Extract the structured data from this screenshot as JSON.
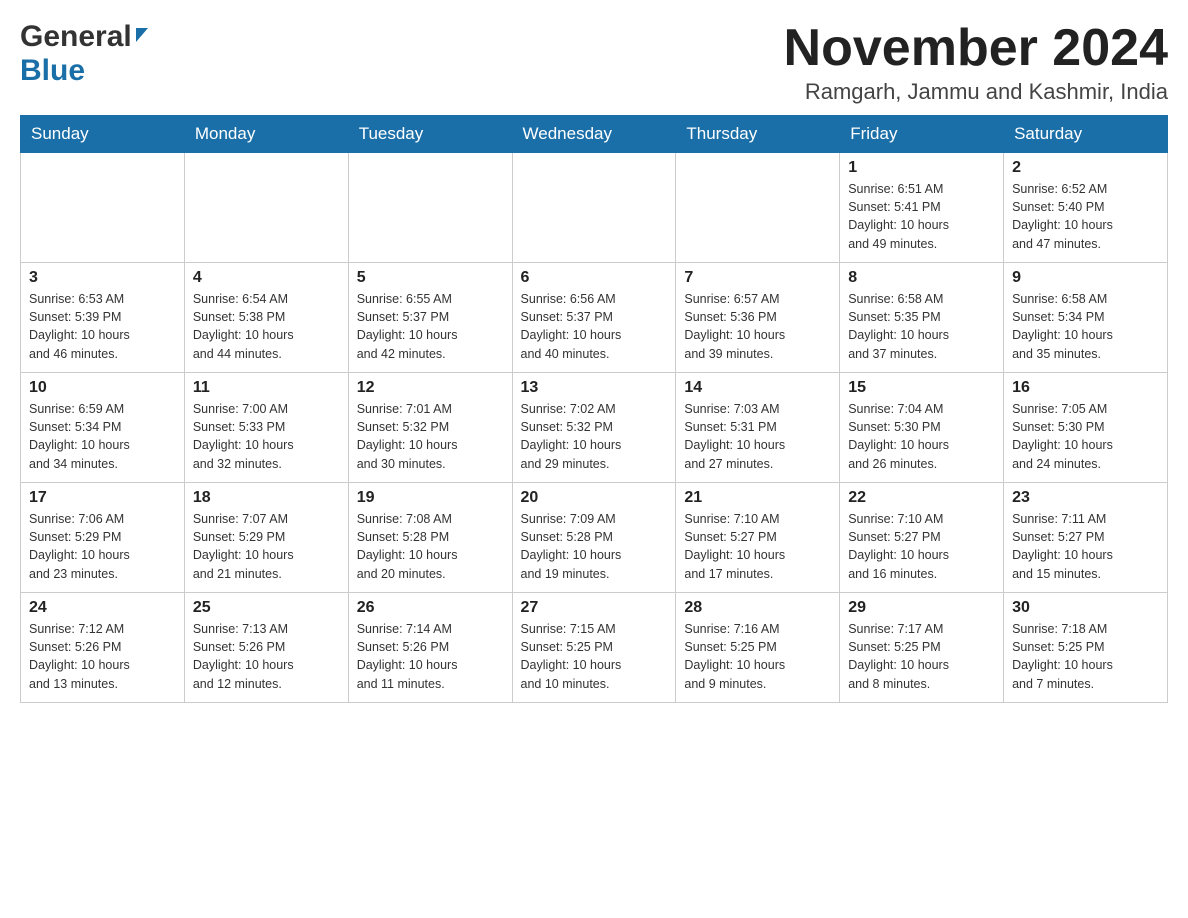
{
  "header": {
    "logo_general": "General",
    "logo_blue": "Blue",
    "month_title": "November 2024",
    "location": "Ramgarh, Jammu and Kashmir, India"
  },
  "weekdays": [
    "Sunday",
    "Monday",
    "Tuesday",
    "Wednesday",
    "Thursday",
    "Friday",
    "Saturday"
  ],
  "weeks": [
    [
      {
        "day": "",
        "info": ""
      },
      {
        "day": "",
        "info": ""
      },
      {
        "day": "",
        "info": ""
      },
      {
        "day": "",
        "info": ""
      },
      {
        "day": "",
        "info": ""
      },
      {
        "day": "1",
        "info": "Sunrise: 6:51 AM\nSunset: 5:41 PM\nDaylight: 10 hours\nand 49 minutes."
      },
      {
        "day": "2",
        "info": "Sunrise: 6:52 AM\nSunset: 5:40 PM\nDaylight: 10 hours\nand 47 minutes."
      }
    ],
    [
      {
        "day": "3",
        "info": "Sunrise: 6:53 AM\nSunset: 5:39 PM\nDaylight: 10 hours\nand 46 minutes."
      },
      {
        "day": "4",
        "info": "Sunrise: 6:54 AM\nSunset: 5:38 PM\nDaylight: 10 hours\nand 44 minutes."
      },
      {
        "day": "5",
        "info": "Sunrise: 6:55 AM\nSunset: 5:37 PM\nDaylight: 10 hours\nand 42 minutes."
      },
      {
        "day": "6",
        "info": "Sunrise: 6:56 AM\nSunset: 5:37 PM\nDaylight: 10 hours\nand 40 minutes."
      },
      {
        "day": "7",
        "info": "Sunrise: 6:57 AM\nSunset: 5:36 PM\nDaylight: 10 hours\nand 39 minutes."
      },
      {
        "day": "8",
        "info": "Sunrise: 6:58 AM\nSunset: 5:35 PM\nDaylight: 10 hours\nand 37 minutes."
      },
      {
        "day": "9",
        "info": "Sunrise: 6:58 AM\nSunset: 5:34 PM\nDaylight: 10 hours\nand 35 minutes."
      }
    ],
    [
      {
        "day": "10",
        "info": "Sunrise: 6:59 AM\nSunset: 5:34 PM\nDaylight: 10 hours\nand 34 minutes."
      },
      {
        "day": "11",
        "info": "Sunrise: 7:00 AM\nSunset: 5:33 PM\nDaylight: 10 hours\nand 32 minutes."
      },
      {
        "day": "12",
        "info": "Sunrise: 7:01 AM\nSunset: 5:32 PM\nDaylight: 10 hours\nand 30 minutes."
      },
      {
        "day": "13",
        "info": "Sunrise: 7:02 AM\nSunset: 5:32 PM\nDaylight: 10 hours\nand 29 minutes."
      },
      {
        "day": "14",
        "info": "Sunrise: 7:03 AM\nSunset: 5:31 PM\nDaylight: 10 hours\nand 27 minutes."
      },
      {
        "day": "15",
        "info": "Sunrise: 7:04 AM\nSunset: 5:30 PM\nDaylight: 10 hours\nand 26 minutes."
      },
      {
        "day": "16",
        "info": "Sunrise: 7:05 AM\nSunset: 5:30 PM\nDaylight: 10 hours\nand 24 minutes."
      }
    ],
    [
      {
        "day": "17",
        "info": "Sunrise: 7:06 AM\nSunset: 5:29 PM\nDaylight: 10 hours\nand 23 minutes."
      },
      {
        "day": "18",
        "info": "Sunrise: 7:07 AM\nSunset: 5:29 PM\nDaylight: 10 hours\nand 21 minutes."
      },
      {
        "day": "19",
        "info": "Sunrise: 7:08 AM\nSunset: 5:28 PM\nDaylight: 10 hours\nand 20 minutes."
      },
      {
        "day": "20",
        "info": "Sunrise: 7:09 AM\nSunset: 5:28 PM\nDaylight: 10 hours\nand 19 minutes."
      },
      {
        "day": "21",
        "info": "Sunrise: 7:10 AM\nSunset: 5:27 PM\nDaylight: 10 hours\nand 17 minutes."
      },
      {
        "day": "22",
        "info": "Sunrise: 7:10 AM\nSunset: 5:27 PM\nDaylight: 10 hours\nand 16 minutes."
      },
      {
        "day": "23",
        "info": "Sunrise: 7:11 AM\nSunset: 5:27 PM\nDaylight: 10 hours\nand 15 minutes."
      }
    ],
    [
      {
        "day": "24",
        "info": "Sunrise: 7:12 AM\nSunset: 5:26 PM\nDaylight: 10 hours\nand 13 minutes."
      },
      {
        "day": "25",
        "info": "Sunrise: 7:13 AM\nSunset: 5:26 PM\nDaylight: 10 hours\nand 12 minutes."
      },
      {
        "day": "26",
        "info": "Sunrise: 7:14 AM\nSunset: 5:26 PM\nDaylight: 10 hours\nand 11 minutes."
      },
      {
        "day": "27",
        "info": "Sunrise: 7:15 AM\nSunset: 5:25 PM\nDaylight: 10 hours\nand 10 minutes."
      },
      {
        "day": "28",
        "info": "Sunrise: 7:16 AM\nSunset: 5:25 PM\nDaylight: 10 hours\nand 9 minutes."
      },
      {
        "day": "29",
        "info": "Sunrise: 7:17 AM\nSunset: 5:25 PM\nDaylight: 10 hours\nand 8 minutes."
      },
      {
        "day": "30",
        "info": "Sunrise: 7:18 AM\nSunset: 5:25 PM\nDaylight: 10 hours\nand 7 minutes."
      }
    ]
  ]
}
